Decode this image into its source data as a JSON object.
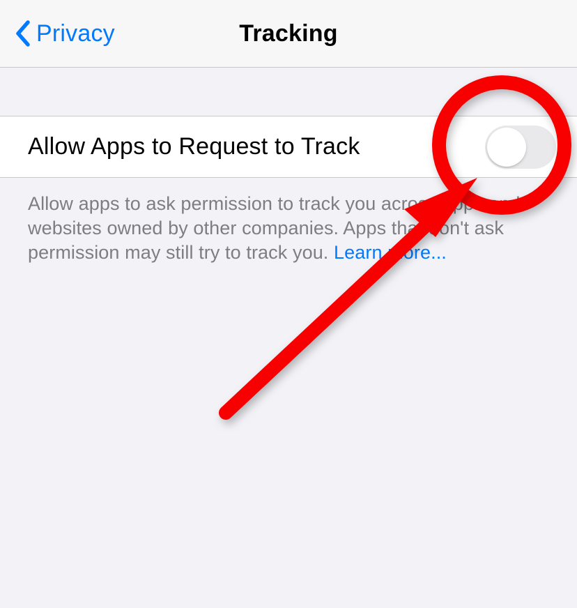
{
  "navbar": {
    "back_label": "Privacy",
    "title": "Tracking"
  },
  "setting": {
    "label": "Allow Apps to Request to Track",
    "toggle_on": false
  },
  "footer": {
    "text": "Allow apps to ask permission to track you across apps and websites owned by other companies. Apps that don't ask permission may still try to track you. ",
    "learn_more": "Learn more..."
  },
  "annotation": {
    "circle_color": "#f90000",
    "arrow_color": "#f90000"
  }
}
